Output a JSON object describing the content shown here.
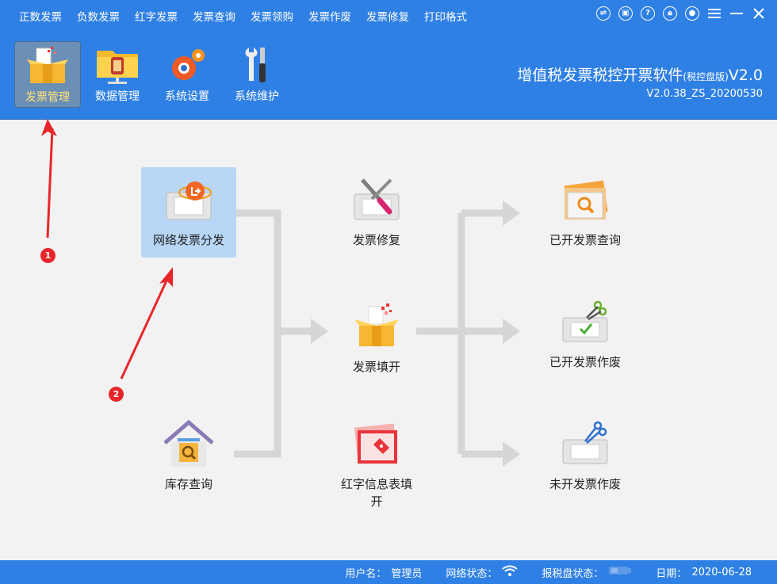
{
  "menu": [
    "正数发票",
    "负数发票",
    "红字发票",
    "发票查询",
    "发票领购",
    "发票作废",
    "发票修复",
    "打印格式"
  ],
  "window_controls": [
    "transfer-icon",
    "clipboard-icon",
    "help-icon",
    "lock-icon",
    "user-icon",
    "menu-icon",
    "minimize-icon",
    "close-icon"
  ],
  "toolbar": [
    {
      "label": "发票管理",
      "icon": "invoice-box-icon",
      "active": true
    },
    {
      "label": "数据管理",
      "icon": "folder-icon",
      "active": false
    },
    {
      "label": "系统设置",
      "icon": "gears-icon",
      "active": false
    },
    {
      "label": "系统维护",
      "icon": "tools-icon",
      "active": false
    }
  ],
  "app": {
    "title": "增值税发票税控开票软件",
    "edition": "(税控盘版)",
    "version": "V2.0",
    "build": "V2.0.38_ZS_20200530"
  },
  "nodes": {
    "network_dist": "网络发票分发",
    "inventory": "库存查询",
    "repair": "发票修复",
    "issue": "发票填开",
    "red_info": "红字信息表填开",
    "query_issued": "已开发票查询",
    "void_issued": "已开发票作废",
    "void_unissued": "未开发票作废"
  },
  "status": {
    "user_label": "用户名：",
    "user": "管理员",
    "net_label": "网络状态：",
    "disk_label": "报税盘状态：",
    "date_label": "日期：",
    "date": "2020-06-28"
  },
  "annotations": [
    "1",
    "2"
  ],
  "colors": {
    "header": "#2f80e4",
    "annotation": "#e8262a",
    "flow": "#d6d6d6",
    "selected": "#b8d7f6"
  }
}
